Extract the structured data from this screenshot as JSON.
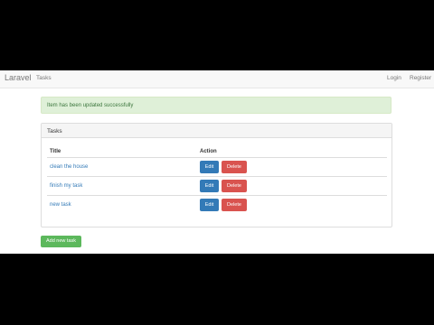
{
  "navbar": {
    "brand": "Laravel",
    "links": [
      "Tasks"
    ],
    "right_links": [
      "Login",
      "Register"
    ]
  },
  "alert": {
    "message": "Item has been updated successfully"
  },
  "panel": {
    "heading": "Tasks",
    "columns": [
      "Title",
      "Action"
    ],
    "rows": [
      {
        "title": "clean the house",
        "edit": "Edit",
        "delete": "Delete"
      },
      {
        "title": "finish my task",
        "edit": "Edit",
        "delete": "Delete"
      },
      {
        "title": "new task",
        "edit": "Edit",
        "delete": "Delete"
      }
    ]
  },
  "add_button": "Add new task",
  "colors": {
    "primary": "#337ab7",
    "danger": "#d9534f",
    "success": "#5cb85c",
    "alert_bg": "#dff0d8",
    "alert_text": "#3c763d"
  }
}
